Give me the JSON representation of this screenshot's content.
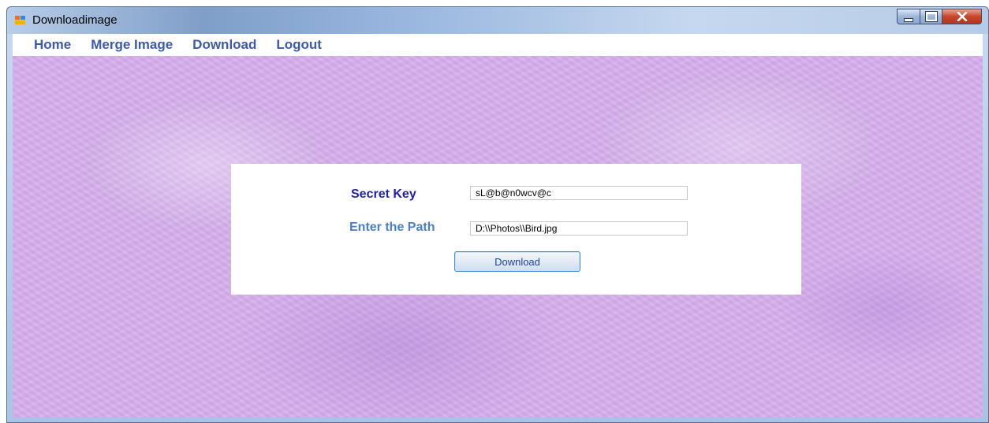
{
  "window": {
    "title": "Downloadimage"
  },
  "menu": {
    "items": [
      {
        "label": "Home"
      },
      {
        "label": "Merge Image"
      },
      {
        "label": "Download"
      },
      {
        "label": "Logout"
      }
    ]
  },
  "form": {
    "secret_key_label": "Secret Key",
    "secret_key_value": "sL@b@n0wcv@c",
    "path_label": "Enter the Path",
    "path_value": "D:\\\\Photos\\\\Bird.jpg",
    "download_button_label": "Download"
  },
  "colors": {
    "background": "#d6b0ec",
    "menu_text": "#3b5aa8",
    "secret_key_label": "#1f1fa8",
    "path_label": "#4a7ec8"
  },
  "icons": {
    "app": "app-icon",
    "minimize": "minimize-icon",
    "maximize": "maximize-icon",
    "close": "close-icon"
  }
}
